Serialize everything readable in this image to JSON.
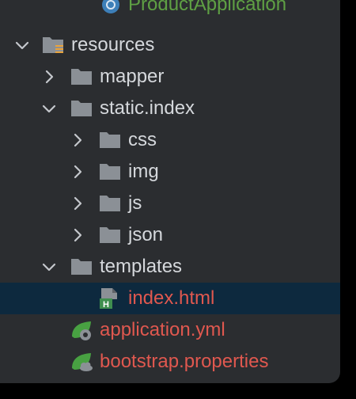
{
  "colors": {
    "panel_bg": "#2b2d30",
    "text": "#d5d8dc",
    "red_text": "#e0584f",
    "green_text": "#5fa044",
    "folder": "#8b9096",
    "selection": "#0d293e",
    "spring_leaf": "#48a142"
  },
  "tree": {
    "partial_item": "ProductApplication",
    "resources": "resources",
    "mapper": "mapper",
    "static_index": "static.index",
    "css": "css",
    "img": "img",
    "js": "js",
    "json": "json",
    "templates": "templates",
    "index_html": "index.html",
    "application_yml": "application.yml",
    "bootstrap_properties": "bootstrap.properties"
  },
  "icons": {
    "folder": "folder-icon",
    "resources_folder": "resources-folder-icon",
    "html_file": "html-file-icon",
    "spring_config": "spring-config-icon",
    "spring_bootstrap": "spring-bootstrap-icon",
    "expanded": "chevron-down-icon",
    "collapsed": "chevron-right-icon"
  }
}
